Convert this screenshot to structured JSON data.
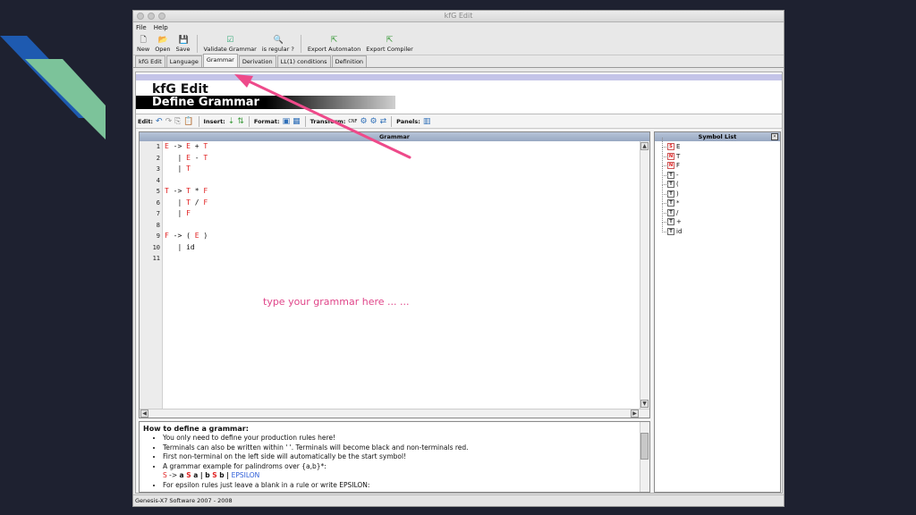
{
  "window": {
    "title": "kfG Edit"
  },
  "menu": [
    "File",
    "Help"
  ],
  "toolbar": {
    "new": "New",
    "open": "Open",
    "save": "Save",
    "validate": "Validate Grammar",
    "regular": "is regular ?",
    "export_automaton": "Export Automaton",
    "export_compiler": "Export Compiler"
  },
  "tabs": [
    "kfG Edit",
    "Language",
    "Grammar",
    "Derivation",
    "LL(1) conditions",
    "Definition"
  ],
  "banner": {
    "title": "kfG Edit",
    "subtitle": "Define Grammar"
  },
  "edit_bar": {
    "edit": "Edit:",
    "insert": "Insert:",
    "format": "Format:",
    "transform": "Transform:",
    "cnf": "CNF",
    "panels": "Panels:"
  },
  "grammar_panel": {
    "header": "Grammar",
    "line_numbers": [
      "1",
      "2",
      "3",
      "4",
      "5",
      "6",
      "7",
      "8",
      "9",
      "10",
      "11"
    ],
    "hint": "type your grammar here ... ..."
  },
  "code_lines": [
    [
      {
        "t": "E",
        "nt": true
      },
      {
        "t": " -> "
      },
      {
        "t": "E",
        "nt": true
      },
      {
        "t": " + "
      },
      {
        "t": "T",
        "nt": true
      }
    ],
    [
      {
        "t": "   | "
      },
      {
        "t": "E",
        "nt": true
      },
      {
        "t": " - "
      },
      {
        "t": "T",
        "nt": true
      }
    ],
    [
      {
        "t": "   | "
      },
      {
        "t": "T",
        "nt": true
      }
    ],
    [],
    [
      {
        "t": "T",
        "nt": true
      },
      {
        "t": " -> "
      },
      {
        "t": "T",
        "nt": true
      },
      {
        "t": " * "
      },
      {
        "t": "F",
        "nt": true
      }
    ],
    [
      {
        "t": "   | "
      },
      {
        "t": "T",
        "nt": true
      },
      {
        "t": " / "
      },
      {
        "t": "F",
        "nt": true
      }
    ],
    [
      {
        "t": "   | "
      },
      {
        "t": "F",
        "nt": true
      }
    ],
    [],
    [
      {
        "t": "F",
        "nt": true
      },
      {
        "t": " -> ( "
      },
      {
        "t": "E",
        "nt": true
      },
      {
        "t": " )"
      }
    ],
    [
      {
        "t": "   | id"
      }
    ],
    []
  ],
  "help": {
    "title": "How to define a grammar:",
    "items": [
      "You only need to define your production rules here!",
      "Terminals can also be written within ' '. Terminals will become black and non-terminals red.",
      "First non-terminal on the left side will automatically be the start symbol!",
      "A grammar example for palindroms over {a,b}*:"
    ],
    "example": {
      "lhs": "S",
      "arrow": " -> ",
      "r1a": "a ",
      "r1s": "S",
      "r1b": " a | ",
      "r2a": "b ",
      "r2s": "S",
      "r2b": " b | ",
      "eps": "EPSILON"
    },
    "last_item": "For epsilon rules just leave a blank in a rule or write EPSILON:"
  },
  "symbol_panel": {
    "header": "Symbol List",
    "symbols": [
      {
        "badge": "S",
        "name": "E",
        "kind": "n"
      },
      {
        "badge": "N",
        "name": "T",
        "kind": "n"
      },
      {
        "badge": "N",
        "name": "F",
        "kind": "n"
      },
      {
        "badge": "T",
        "name": "-",
        "kind": "t"
      },
      {
        "badge": "T",
        "name": "(",
        "kind": "t"
      },
      {
        "badge": "T",
        "name": ")",
        "kind": "t"
      },
      {
        "badge": "T",
        "name": "*",
        "kind": "t"
      },
      {
        "badge": "T",
        "name": "/",
        "kind": "t"
      },
      {
        "badge": "T",
        "name": "+",
        "kind": "t"
      },
      {
        "badge": "T",
        "name": "id",
        "kind": "t"
      }
    ]
  },
  "status": "Genesis-X7 Software 2007 - 2008",
  "colors": {
    "nonterminal": "#e02020",
    "hint": "#e0468a",
    "arrow": "#ee4a8a",
    "epsilon": "#2a5bd7"
  }
}
